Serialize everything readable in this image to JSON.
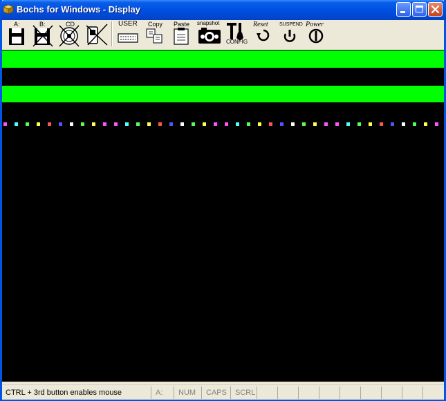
{
  "window": {
    "title": "Bochs for Windows - Display"
  },
  "toolbar": {
    "floppy_a_label": "A:",
    "floppy_b_label": "B:",
    "cdrom_label": "CD",
    "user_label": "USER",
    "copy_label": "Copy",
    "paste_label": "Paste",
    "snapshot_label": "snapshot",
    "config_label": "CONFIG",
    "reset_label": "Reset",
    "suspend_label": "SUSPEND",
    "power_label": "Power"
  },
  "colors": {
    "titlebar": "#0050e0",
    "display_bg": "#000000",
    "graphics_bar": "#00ff00"
  },
  "statusbar": {
    "message": "CTRL + 3rd button enables mouse",
    "drive": "A:",
    "num": "NUM",
    "caps": "CAPS",
    "scrl": "SCRL"
  }
}
